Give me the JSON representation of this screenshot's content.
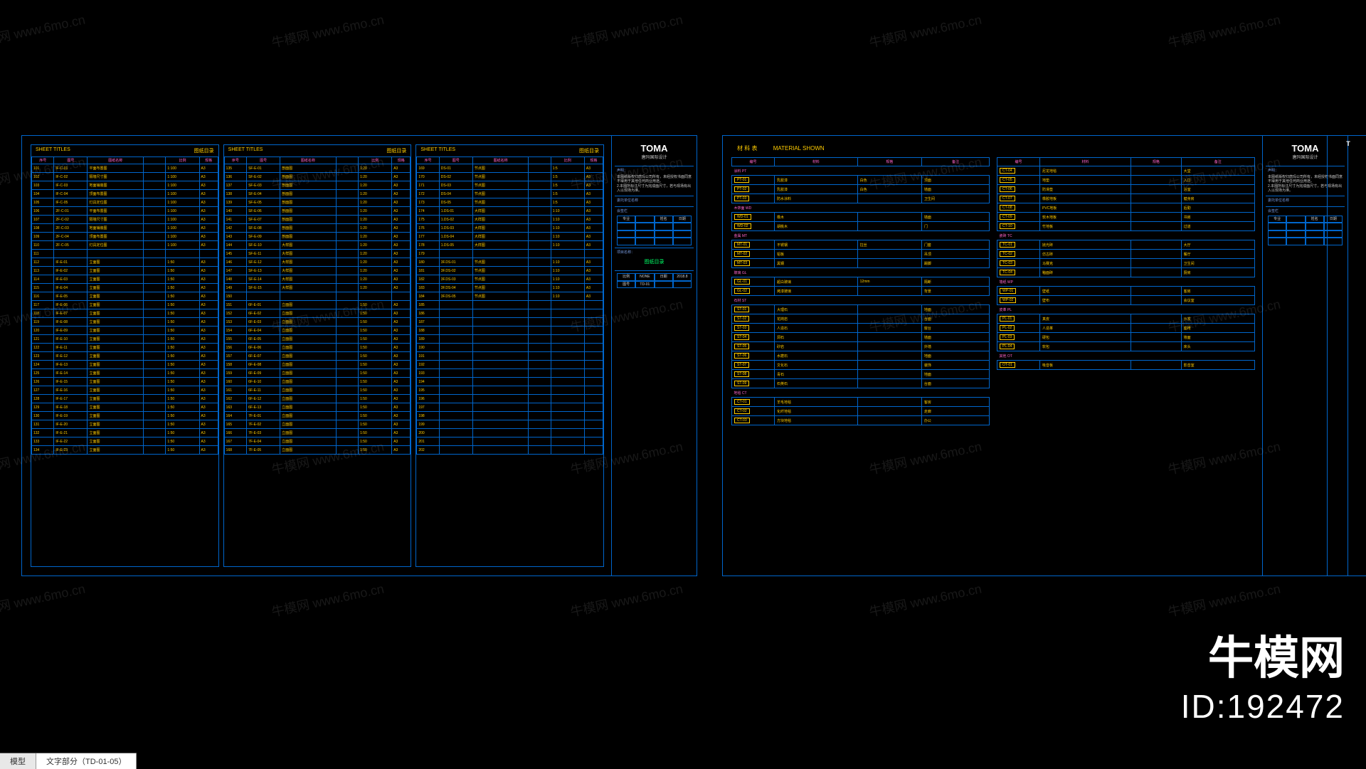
{
  "brand": {
    "name": "牛模网",
    "id": "ID:192472"
  },
  "watermark": "牛模网 www.6mo.cn",
  "tabs": {
    "model": "模型",
    "text_part": "文字部分（TD-01-05）"
  },
  "titleblock": {
    "logo": "TOMA",
    "logo_sub": "唐玛国际设计",
    "notes_label": "声明：",
    "notes": "本图纸版权归唐玛公司所有，未经授权书面同意不得用于其他任何商业用途。",
    "notes2": "2.本图所标注尺寸为完成面尺寸，若与现场有出入以现场为准。",
    "client_label": "委托单位名称",
    "rev_label": "会签栏",
    "grid_headers": [
      "专业",
      "",
      "姓名",
      "日期"
    ],
    "project_label": "项目名称：",
    "project": "图纸目录",
    "scale_label": "比例",
    "scale": "NONE",
    "date_label": "日期",
    "date": "2018.8",
    "dwg_label": "图号",
    "dwg": "TD-01"
  },
  "sheet_titles": {
    "header_en": "SHEET TITLES",
    "header_cn": "图纸目录",
    "cols": [
      "序号",
      "图号",
      "图纸名称",
      "",
      "比例",
      "规格"
    ],
    "table1": [
      [
        "101",
        "IF-C-01",
        "平面布置图",
        "",
        "1:100",
        "A3"
      ],
      [
        "102",
        "IF-C-02",
        "隔墙尺寸图",
        "",
        "1:100",
        "A3"
      ],
      [
        "103",
        "IF-C-03",
        "地面铺装图",
        "",
        "1:100",
        "A3"
      ],
      [
        "104",
        "IF-C-04",
        "顶面布置图",
        "",
        "1:100",
        "A3"
      ],
      [
        "105",
        "IF-C-05",
        "灯具定位图",
        "",
        "1:100",
        "A3"
      ],
      [
        "106",
        "2F-C-01",
        "平面布置图",
        "",
        "1:100",
        "A3"
      ],
      [
        "107",
        "2F-C-02",
        "隔墙尺寸图",
        "",
        "1:100",
        "A3"
      ],
      [
        "108",
        "2F-C-03",
        "地面铺装图",
        "",
        "1:100",
        "A3"
      ],
      [
        "109",
        "2F-C-04",
        "顶面布置图",
        "",
        "1:100",
        "A3"
      ],
      [
        "110",
        "2F-C-05",
        "灯具定位图",
        "",
        "1:100",
        "A3"
      ],
      [
        "111",
        "",
        "",
        "",
        "",
        ""
      ],
      [
        "112",
        "IF-E-01",
        "立面图",
        "",
        "1:50",
        "A3"
      ],
      [
        "113",
        "IF-E-02",
        "立面图",
        "",
        "1:50",
        "A3"
      ],
      [
        "114",
        "IF-E-03",
        "立面图",
        "",
        "1:50",
        "A3"
      ],
      [
        "115",
        "IF-E-04",
        "立面图",
        "",
        "1:50",
        "A3"
      ],
      [
        "116",
        "IF-E-05",
        "立面图",
        "",
        "1:50",
        "A3"
      ],
      [
        "117",
        "IF-E-06",
        "立面图",
        "",
        "1:50",
        "A3"
      ],
      [
        "118",
        "IF-E-07",
        "立面图",
        "",
        "1:50",
        "A3"
      ],
      [
        "119",
        "IF-E-08",
        "立面图",
        "",
        "1:50",
        "A3"
      ],
      [
        "120",
        "IF-E-09",
        "立面图",
        "",
        "1:50",
        "A3"
      ],
      [
        "121",
        "IF-E-10",
        "立面图",
        "",
        "1:50",
        "A3"
      ],
      [
        "122",
        "IF-E-11",
        "立面图",
        "",
        "1:50",
        "A3"
      ],
      [
        "123",
        "IF-E-12",
        "立面图",
        "",
        "1:50",
        "A3"
      ],
      [
        "124",
        "IF-E-13",
        "立面图",
        "",
        "1:50",
        "A3"
      ],
      [
        "125",
        "IF-E-14",
        "立面图",
        "",
        "1:50",
        "A3"
      ],
      [
        "126",
        "IF-E-15",
        "立面图",
        "",
        "1:50",
        "A3"
      ],
      [
        "127",
        "IF-E-16",
        "立面图",
        "",
        "1:50",
        "A3"
      ],
      [
        "128",
        "IF-E-17",
        "立面图",
        "",
        "1:50",
        "A3"
      ],
      [
        "129",
        "IF-E-18",
        "立面图",
        "",
        "1:50",
        "A3"
      ],
      [
        "130",
        "IF-E-19",
        "立面图",
        "",
        "1:50",
        "A3"
      ],
      [
        "131",
        "IF-E-20",
        "立面图",
        "",
        "1:50",
        "A3"
      ],
      [
        "132",
        "IF-E-21",
        "立面图",
        "",
        "1:50",
        "A3"
      ],
      [
        "133",
        "IF-E-22",
        "立面图",
        "",
        "1:50",
        "A3"
      ],
      [
        "134",
        "IF-E-23",
        "立面图",
        "",
        "1:50",
        "A3"
      ]
    ],
    "table2": [
      [
        "135",
        "SF-E-01",
        "剖面图",
        "",
        "1:20",
        "A3"
      ],
      [
        "136",
        "SF-E-02",
        "剖面图",
        "",
        "1:20",
        "A3"
      ],
      [
        "137",
        "SF-E-03",
        "剖面图",
        "",
        "1:20",
        "A3"
      ],
      [
        "138",
        "SF-E-04",
        "剖面图",
        "",
        "1:20",
        "A3"
      ],
      [
        "139",
        "SF-E-05",
        "剖面图",
        "",
        "1:20",
        "A3"
      ],
      [
        "140",
        "SF-E-06",
        "剖面图",
        "",
        "1:20",
        "A3"
      ],
      [
        "141",
        "SF-E-07",
        "剖面图",
        "",
        "1:20",
        "A3"
      ],
      [
        "142",
        "SF-E-08",
        "剖面图",
        "",
        "1:20",
        "A3"
      ],
      [
        "143",
        "SF-E-09",
        "剖面图",
        "",
        "1:20",
        "A3"
      ],
      [
        "144",
        "SF-E-10",
        "大样图",
        "",
        "1:20",
        "A3"
      ],
      [
        "145",
        "SF-E-11",
        "大样图",
        "",
        "1:20",
        "A3"
      ],
      [
        "146",
        "SF-E-12",
        "大样图",
        "",
        "1:20",
        "A3"
      ],
      [
        "147",
        "SF-E-13",
        "大样图",
        "",
        "1:20",
        "A3"
      ],
      [
        "148",
        "SF-E-14",
        "大样图",
        "",
        "1:20",
        "A3"
      ],
      [
        "149",
        "SF-E-15",
        "大样图",
        "",
        "1:20",
        "A3"
      ],
      [
        "150",
        "",
        "",
        "",
        "",
        ""
      ],
      [
        "151",
        "6F-E-01",
        "立面图",
        "",
        "1:50",
        "A3"
      ],
      [
        "152",
        "6F-E-02",
        "立面图",
        "",
        "1:50",
        "A3"
      ],
      [
        "153",
        "6F-E-03",
        "立面图",
        "",
        "1:50",
        "A3"
      ],
      [
        "154",
        "6F-E-04",
        "立面图",
        "",
        "1:50",
        "A3"
      ],
      [
        "155",
        "6F-E-05",
        "立面图",
        "",
        "1:50",
        "A3"
      ],
      [
        "156",
        "6F-E-06",
        "立面图",
        "",
        "1:50",
        "A3"
      ],
      [
        "157",
        "6F-E-07",
        "立面图",
        "",
        "1:50",
        "A3"
      ],
      [
        "158",
        "6F-E-08",
        "立面图",
        "",
        "1:50",
        "A3"
      ],
      [
        "159",
        "6F-E-09",
        "立面图",
        "",
        "1:50",
        "A3"
      ],
      [
        "160",
        "6F-E-10",
        "立面图",
        "",
        "1:50",
        "A3"
      ],
      [
        "161",
        "6F-E-11",
        "立面图",
        "",
        "1:50",
        "A3"
      ],
      [
        "162",
        "6F-E-12",
        "立面图",
        "",
        "1:50",
        "A3"
      ],
      [
        "163",
        "6F-E-13",
        "立面图",
        "",
        "1:50",
        "A3"
      ],
      [
        "164",
        "7F-E-01",
        "立面图",
        "",
        "1:50",
        "A3"
      ],
      [
        "165",
        "7F-E-02",
        "立面图",
        "",
        "1:50",
        "A3"
      ],
      [
        "166",
        "7F-E-03",
        "立面图",
        "",
        "1:50",
        "A3"
      ],
      [
        "167",
        "7F-E-04",
        "立面图",
        "",
        "1:50",
        "A3"
      ],
      [
        "168",
        "7F-E-05",
        "立面图",
        "",
        "1:50",
        "A3"
      ]
    ],
    "table3": [
      [
        "169",
        "DS-01",
        "节点图",
        "",
        "1:5",
        "A3"
      ],
      [
        "170",
        "DS-02",
        "节点图",
        "",
        "1:5",
        "A3"
      ],
      [
        "171",
        "DS-03",
        "节点图",
        "",
        "1:5",
        "A3"
      ],
      [
        "172",
        "DS-04",
        "节点图",
        "",
        "1:5",
        "A3"
      ],
      [
        "173",
        "DS-05",
        "节点图",
        "",
        "1:5",
        "A3"
      ],
      [
        "174",
        "1.DS-01",
        "大样图",
        "",
        "1:10",
        "A3"
      ],
      [
        "175",
        "1.DS-02",
        "大样图",
        "",
        "1:10",
        "A3"
      ],
      [
        "176",
        "1.DS-03",
        "大样图",
        "",
        "1:10",
        "A3"
      ],
      [
        "177",
        "1.DS-04",
        "大样图",
        "",
        "1:10",
        "A3"
      ],
      [
        "178",
        "1.DS-05",
        "大样图",
        "",
        "1:10",
        "A3"
      ],
      [
        "179",
        "",
        "",
        "",
        "",
        ""
      ],
      [
        "180",
        "3F.DS-01",
        "节点图",
        "",
        "1:10",
        "A3"
      ],
      [
        "181",
        "3F.DS-02",
        "节点图",
        "",
        "1:10",
        "A3"
      ],
      [
        "182",
        "3F.DS-03",
        "节点图",
        "",
        "1:10",
        "A3"
      ],
      [
        "183",
        "3F.DS-04",
        "节点图",
        "",
        "1:10",
        "A3"
      ],
      [
        "184",
        "3F.DS-05",
        "节点图",
        "",
        "1:10",
        "A3"
      ],
      [
        "185",
        "",
        "",
        "",
        "",
        ""
      ],
      [
        "186",
        "",
        "",
        "",
        "",
        ""
      ],
      [
        "187",
        "",
        "",
        "",
        "",
        ""
      ],
      [
        "188",
        "",
        "",
        "",
        "",
        ""
      ],
      [
        "189",
        "",
        "",
        "",
        "",
        ""
      ],
      [
        "190",
        "",
        "",
        "",
        "",
        ""
      ],
      [
        "191",
        "",
        "",
        "",
        "",
        ""
      ],
      [
        "192",
        "",
        "",
        "",
        "",
        ""
      ],
      [
        "193",
        "",
        "",
        "",
        "",
        ""
      ],
      [
        "194",
        "",
        "",
        "",
        "",
        ""
      ],
      [
        "195",
        "",
        "",
        "",
        "",
        ""
      ],
      [
        "196",
        "",
        "",
        "",
        "",
        ""
      ],
      [
        "197",
        "",
        "",
        "",
        "",
        ""
      ],
      [
        "198",
        "",
        "",
        "",
        "",
        ""
      ],
      [
        "199",
        "",
        "",
        "",
        "",
        ""
      ],
      [
        "200",
        "",
        "",
        "",
        "",
        ""
      ],
      [
        "201",
        "",
        "",
        "",
        "",
        ""
      ],
      [
        "202",
        "",
        "",
        "",
        "",
        ""
      ]
    ]
  },
  "material": {
    "title_cn": "材 料 表",
    "title_en": "MATERIAL SHOWN",
    "cols": [
      "编号",
      "材料",
      "规格",
      "备注"
    ],
    "sections1": [
      {
        "name": "涂料 PT",
        "rows": [
          [
            "PT-01",
            "乳胶漆",
            "白色",
            "顶面"
          ],
          [
            "PT-02",
            "乳胶漆",
            "白色",
            "墙面"
          ],
          [
            "PT-03",
            "防水涂料",
            "",
            "卫生间"
          ]
        ]
      },
      {
        "name": "木饰面 WD",
        "rows": [
          [
            "WD-01",
            "橡木",
            "",
            "墙面"
          ],
          [
            "WD-02",
            "胡桃木",
            "",
            "门"
          ]
        ]
      },
      {
        "name": "金属 MT",
        "rows": [
          [
            "MT-01",
            "不锈钢",
            "拉丝",
            "门套"
          ],
          [
            "MT-02",
            "铝板",
            "",
            "吊顶"
          ],
          [
            "MT-03",
            "黑钢",
            "",
            "踢脚"
          ]
        ]
      },
      {
        "name": "玻璃 GL",
        "rows": [
          [
            "GL-01",
            "超白玻璃",
            "12mm",
            "隔断"
          ],
          [
            "GL-02",
            "烤漆玻璃",
            "",
            "背景"
          ]
        ]
      },
      {
        "name": "石材 ST",
        "rows": [
          [
            "ST-01",
            "大理石",
            "",
            "地面"
          ],
          [
            "ST-02",
            "花岗岩",
            "",
            "台面"
          ],
          [
            "ST-03",
            "人造石",
            "",
            "窗台"
          ],
          [
            "ST-04",
            "洞石",
            "",
            "墙面"
          ],
          [
            "ST-05",
            "砂岩",
            "",
            "外墙"
          ],
          [
            "ST-06",
            "水磨石",
            "",
            "地面"
          ],
          [
            "ST-07",
            "文化石",
            "",
            "装饰"
          ],
          [
            "ST-08",
            "青石",
            "",
            "地面"
          ],
          [
            "ST-09",
            "石英石",
            "",
            "台面"
          ]
        ]
      },
      {
        "name": "地毯 CT",
        "rows": [
          [
            "CT-01",
            "羊毛地毯",
            "",
            "客房"
          ],
          [
            "CT-02",
            "化纤地毯",
            "",
            "走廊"
          ],
          [
            "CT-03",
            "方块地毯",
            "",
            "办公"
          ]
        ]
      }
    ],
    "sections2": [
      {
        "name": "",
        "rows": [
          [
            "CT-04",
            "尼龙地毯",
            "",
            "大堂"
          ],
          [
            "CT-05",
            "地垫",
            "",
            "入口"
          ],
          [
            "CT-06",
            "防滑垫",
            "",
            "浴室"
          ],
          [
            "CT-07",
            "橡胶地板",
            "",
            "健身房"
          ],
          [
            "CT-08",
            "PVC地板",
            "",
            "后勤"
          ],
          [
            "CT-09",
            "软木地板",
            "",
            "书房"
          ],
          [
            "CT-10",
            "竹地板",
            "",
            "过道"
          ]
        ]
      },
      {
        "name": "瓷砖 TC",
        "rows": [
          [
            "TC-01",
            "抛光砖",
            "",
            "大厅"
          ],
          [
            "TC-02",
            "仿古砖",
            "",
            "餐厅"
          ],
          [
            "TC-03",
            "马赛克",
            "",
            "卫生间"
          ],
          [
            "TC-04",
            "釉面砖",
            "",
            "厨房"
          ]
        ]
      },
      {
        "name": "墙纸 WP",
        "rows": [
          [
            "WP-01",
            "壁纸",
            "",
            "客房"
          ],
          [
            "WP-02",
            "壁布",
            "",
            "会议室"
          ]
        ]
      },
      {
        "name": "皮革 PL",
        "rows": [
          [
            "PL-01",
            "真皮",
            "",
            "沙发"
          ],
          [
            "PL-02",
            "人造革",
            "",
            "座椅"
          ],
          [
            "PL-03",
            "硬包",
            "",
            "墙面"
          ],
          [
            "PL-04",
            "软包",
            "",
            "床头"
          ]
        ]
      },
      {
        "name": "其他 OT",
        "rows": [
          [
            "OT-01",
            "吸音板",
            "",
            "影音室"
          ]
        ]
      }
    ]
  }
}
